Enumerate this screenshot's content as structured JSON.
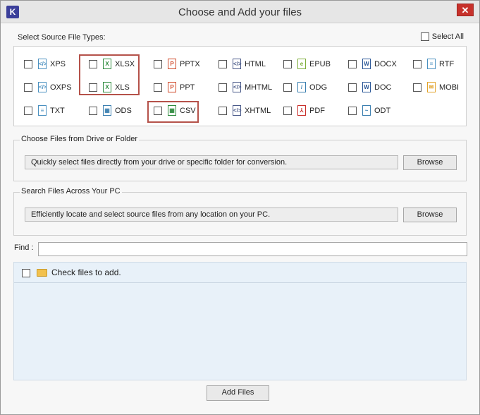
{
  "window": {
    "title": "Choose and Add your files",
    "app_icon": "K",
    "close": "✕"
  },
  "file_types": {
    "label": "Select Source File Types:",
    "select_all": "Select All",
    "items": [
      {
        "label": "XPS",
        "icon": "xps-icon",
        "glyph": "</>",
        "color": "#4a90c0"
      },
      {
        "label": "XLSX",
        "icon": "xlsx-icon",
        "glyph": "X",
        "color": "#2e8b3e"
      },
      {
        "label": "PPTX",
        "icon": "pptx-icon",
        "glyph": "P",
        "color": "#d04a2b"
      },
      {
        "label": "HTML",
        "icon": "html-icon",
        "glyph": "</>",
        "color": "#4a5a8a"
      },
      {
        "label": "EPUB",
        "icon": "epub-icon",
        "glyph": "e",
        "color": "#7fae3c"
      },
      {
        "label": "DOCX",
        "icon": "docx-icon",
        "glyph": "W",
        "color": "#2b5797"
      },
      {
        "label": "RTF",
        "icon": "rtf-icon",
        "glyph": "≡",
        "color": "#4a90c0"
      },
      {
        "label": "OXPS",
        "icon": "oxps-icon",
        "glyph": "</>",
        "color": "#4a90c0"
      },
      {
        "label": "XLS",
        "icon": "xls-icon",
        "glyph": "X",
        "color": "#2e8b3e"
      },
      {
        "label": "PPT",
        "icon": "ppt-icon",
        "glyph": "P",
        "color": "#d04a2b"
      },
      {
        "label": "MHTML",
        "icon": "mhtml-icon",
        "glyph": "</>",
        "color": "#4a5a8a"
      },
      {
        "label": "ODG",
        "icon": "odg-icon",
        "glyph": "/",
        "color": "#3b7fb0"
      },
      {
        "label": "DOC",
        "icon": "doc-icon",
        "glyph": "W",
        "color": "#2b5797"
      },
      {
        "label": "MOBI",
        "icon": "mobi-icon",
        "glyph": "✉",
        "color": "#e2a32a"
      },
      {
        "label": "TXT",
        "icon": "txt-icon",
        "glyph": "≡",
        "color": "#4a90c0"
      },
      {
        "label": "ODS",
        "icon": "ods-icon",
        "glyph": "▦",
        "color": "#3b7fb0"
      },
      {
        "label": "CSV",
        "icon": "csv-icon",
        "glyph": "▦",
        "color": "#2e8b3e"
      },
      {
        "label": "XHTML",
        "icon": "xhtml-icon",
        "glyph": "</>",
        "color": "#4a5a8a"
      },
      {
        "label": "PDF",
        "icon": "pdf-icon",
        "glyph": "⅄",
        "color": "#c9302c"
      },
      {
        "label": "ODT",
        "icon": "odt-icon",
        "glyph": "~",
        "color": "#3b7fb0"
      }
    ]
  },
  "drive_section": {
    "title": "Choose Files from Drive or Folder",
    "description": "Quickly select files directly from your drive or specific folder for conversion.",
    "button": "Browse"
  },
  "search_section": {
    "title": "Search Files Across Your PC",
    "description": "Efficiently locate and select source files from any location on your PC.",
    "button": "Browse"
  },
  "find": {
    "label": "Find :",
    "value": ""
  },
  "files_list": {
    "header": "Check files to add."
  },
  "footer": {
    "add_button": "Add Files"
  }
}
